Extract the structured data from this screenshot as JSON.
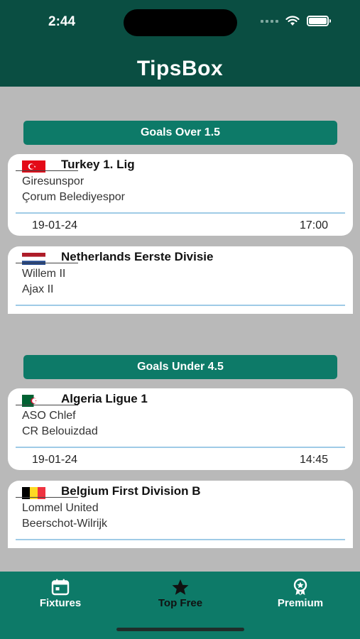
{
  "status_bar": {
    "time": "2:44"
  },
  "app": {
    "title": "TipsBox"
  },
  "sections": [
    {
      "title": "Goals Over 1.5",
      "matches": [
        {
          "flag": "turkey",
          "league": "Turkey 1. Lig",
          "home": "Giresunspor",
          "away": "Çorum Belediyespor",
          "date": "19-01-24",
          "time": "17:00"
        },
        {
          "flag": "netherlands",
          "league": "Netherlands Eerste Divisie",
          "home": "Willem II",
          "away": "Ajax II"
        }
      ]
    },
    {
      "title": "Goals Under 4.5",
      "matches": [
        {
          "flag": "algeria",
          "league": "Algeria Ligue 1",
          "home": "ASO Chlef",
          "away": "CR Belouizdad",
          "date": "19-01-24",
          "time": "14:45"
        },
        {
          "flag": "belgium",
          "league": "Belgium First Division B",
          "home": "Lommel United",
          "away": "Beerschot-Wilrijk"
        }
      ]
    }
  ],
  "tabs": [
    {
      "label": "Fixtures",
      "icon": "calendar-icon"
    },
    {
      "label": "Top Free",
      "icon": "star-icon",
      "active": true
    },
    {
      "label": "Premium",
      "icon": "award-icon"
    }
  ],
  "colors": {
    "header": "#0a4e42",
    "accent": "#0d7a68",
    "background": "#b9b9b9",
    "divider": "#9fcbe6"
  }
}
